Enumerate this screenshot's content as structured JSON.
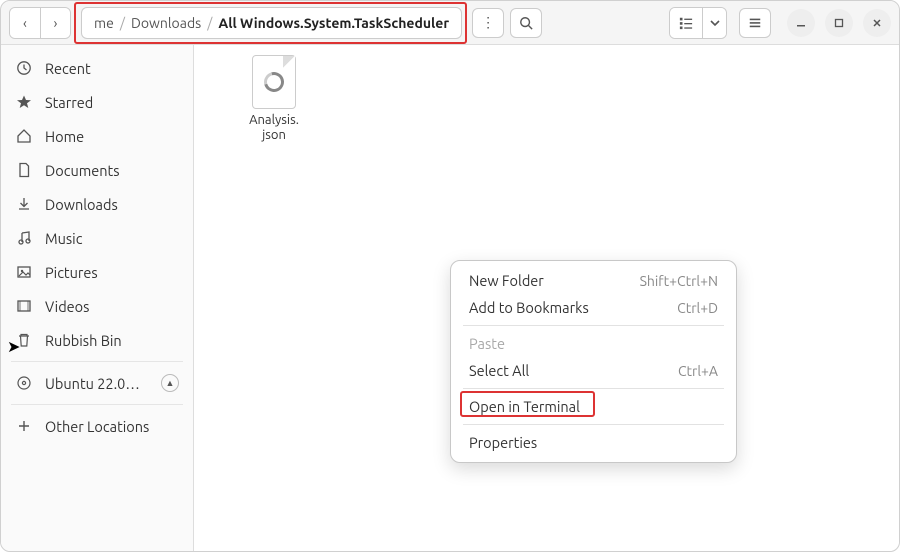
{
  "path": {
    "truncated_prefix": "me",
    "seg1": "Downloads",
    "seg2": "All Windows.System.TaskScheduler"
  },
  "sidebar": {
    "items": [
      {
        "label": "Recent"
      },
      {
        "label": "Starred"
      },
      {
        "label": "Home"
      },
      {
        "label": "Documents"
      },
      {
        "label": "Downloads"
      },
      {
        "label": "Music"
      },
      {
        "label": "Pictures"
      },
      {
        "label": "Videos"
      },
      {
        "label": "Rubbish Bin"
      }
    ],
    "mount": {
      "label": "Ubuntu 22.0…"
    },
    "other": {
      "label": "Other Locations"
    }
  },
  "files": [
    {
      "name": "Analysis.\njson"
    }
  ],
  "context_menu": {
    "items": [
      {
        "label": "New Folder",
        "accel": "Shift+Ctrl+N",
        "disabled": false
      },
      {
        "label": "Add to Bookmarks",
        "accel": "Ctrl+D",
        "disabled": false
      },
      {
        "label": "Paste",
        "disabled": true
      },
      {
        "label": "Select All",
        "accel": "Ctrl+A",
        "disabled": false
      },
      {
        "label": "Open in Terminal",
        "disabled": false
      },
      {
        "label": "Properties",
        "disabled": false
      }
    ]
  }
}
